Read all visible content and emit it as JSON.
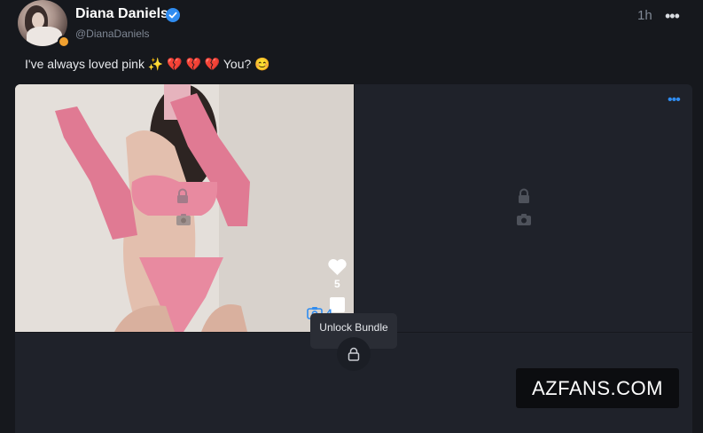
{
  "post": {
    "author_name": "Diana Daniels",
    "author_handle": "@DianaDaniels",
    "time_ago": "1h",
    "more_icon": "•••",
    "caption": "I've always loved pink ✨ 💔 💔 💔  You? 😊"
  },
  "media": {
    "more_icon": "•••",
    "likes": "5",
    "media_count": "4",
    "tooltip": "Unlock Bundle"
  },
  "watermark": "AZFANS.COM",
  "colors": {
    "accent": "#2f8cf0",
    "background": "#16181d",
    "panel": "#1f222a"
  }
}
